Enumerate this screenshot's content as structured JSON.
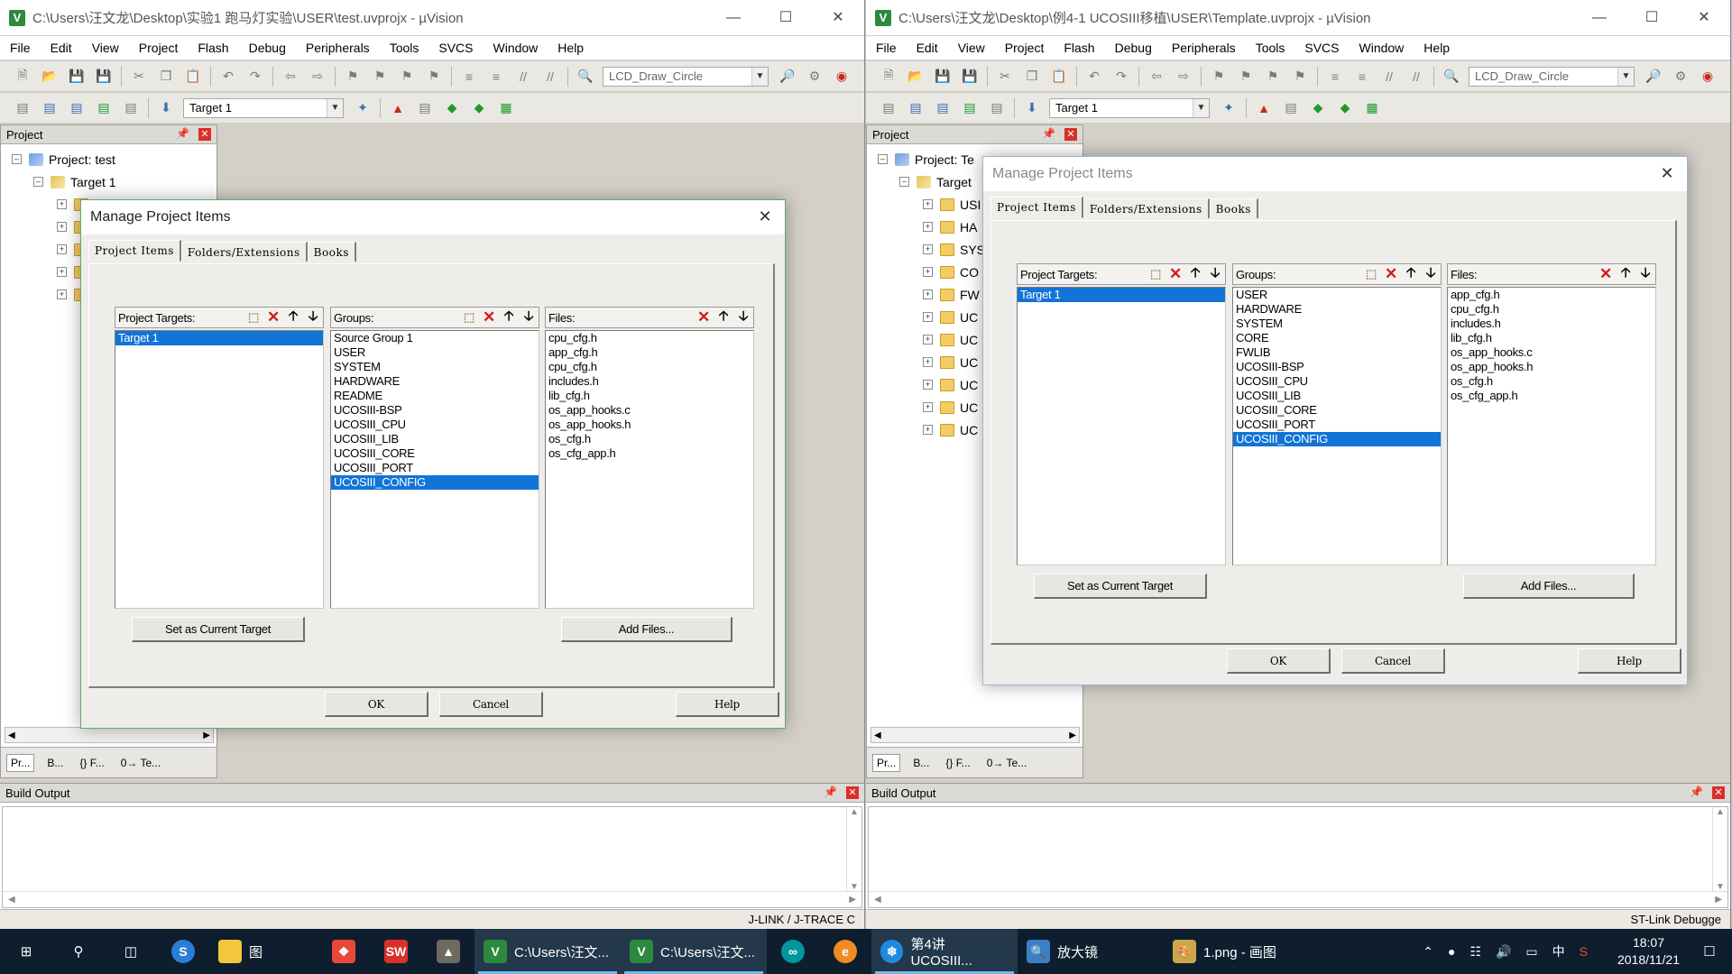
{
  "menu": [
    "File",
    "Edit",
    "View",
    "Project",
    "Flash",
    "Debug",
    "Peripherals",
    "Tools",
    "SVCS",
    "Window",
    "Help"
  ],
  "left": {
    "title": "C:\\Users\\汪文龙\\Desktop\\实验1 跑马灯实验\\USER\\test.uvprojx - µVision",
    "find_combo": "LCD_Draw_Circle",
    "target_combo": "Target 1",
    "panel_title": "Project",
    "tree_project": "Project: test",
    "tree_target": "Target 1",
    "bottom_tabs": [
      "Pr...",
      "B...",
      "{} F...",
      "0→ Te..."
    ],
    "build_output_title": "Build Output",
    "status": "J-LINK / J-TRACE C",
    "dialog": {
      "title": "Manage Project Items",
      "tabs": [
        "Project Items",
        "Folders/Extensions",
        "Books"
      ],
      "targets_label": "Project Targets:",
      "groups_label": "Groups:",
      "files_label": "Files:",
      "targets": [
        "Target 1"
      ],
      "selected_target": "Target 1",
      "groups": [
        "Source Group 1",
        "USER",
        "SYSTEM",
        "HARDWARE",
        "README",
        "UCOSIII-BSP",
        "UCOSIII_CPU",
        "UCOSIII_LIB",
        "UCOSIII_CORE",
        "UCOSIII_PORT",
        "UCOSIII_CONFIG"
      ],
      "selected_group": "UCOSIII_CONFIG",
      "files": [
        "cpu_cfg.h",
        "app_cfg.h",
        "cpu_cfg.h",
        "includes.h",
        "lib_cfg.h",
        "os_app_hooks.c",
        "os_app_hooks.h",
        "os_cfg.h",
        "os_cfg_app.h"
      ],
      "set_current_target": "Set as Current Target",
      "add_files": "Add Files...",
      "ok": "OK",
      "cancel": "Cancel",
      "help": "Help"
    }
  },
  "right": {
    "title": "C:\\Users\\汪文龙\\Desktop\\例4-1 UCOSIII移植\\USER\\Template.uvprojx - µVision",
    "find_combo": "LCD_Draw_Circle",
    "target_combo": "Target 1",
    "panel_title": "Project",
    "tree_project": "Project: Te",
    "tree_target": "Target",
    "tree_folders": [
      "USI",
      "HA",
      "SYS",
      "CO",
      "FW",
      "UC",
      "UC",
      "UC",
      "UC",
      "UC",
      "UC"
    ],
    "bottom_tabs": [
      "Pr...",
      "B...",
      "{} F...",
      "0→ Te..."
    ],
    "build_output_title": "Build Output",
    "status": "ST-Link Debugge",
    "dialog": {
      "title": "Manage Project Items",
      "tabs": [
        "Project Items",
        "Folders/Extensions",
        "Books"
      ],
      "targets_label": "Project Targets:",
      "groups_label": "Groups:",
      "files_label": "Files:",
      "targets": [
        "Target 1"
      ],
      "selected_target": "Target 1",
      "groups": [
        "USER",
        "HARDWARE",
        "SYSTEM",
        "CORE",
        "FWLIB",
        "UCOSIII-BSP",
        "UCOSIII_CPU",
        "UCOSIII_LIB",
        "UCOSIII_CORE",
        "UCOSIII_PORT",
        "UCOSIII_CONFIG"
      ],
      "selected_group": "UCOSIII_CONFIG",
      "files": [
        "app_cfg.h",
        "cpu_cfg.h",
        "includes.h",
        "lib_cfg.h",
        "os_app_hooks.c",
        "os_app_hooks.h",
        "os_cfg.h",
        "os_cfg_app.h"
      ],
      "set_current_target": "Set as Current Target",
      "add_files": "Add Files...",
      "ok": "OK",
      "cancel": "Cancel",
      "help": "Help"
    }
  },
  "taskbar": {
    "items": [
      {
        "icon": "windows-start-icon",
        "label": ""
      },
      {
        "icon": "search-icon",
        "label": ""
      },
      {
        "icon": "task-view-icon",
        "label": ""
      },
      {
        "icon": "browser-icon",
        "label": ""
      },
      {
        "icon": "file-explorer-icon",
        "label": "图"
      },
      {
        "icon": "app-icon",
        "label": ""
      },
      {
        "icon": "solidworks-icon",
        "label": ""
      },
      {
        "icon": "app-icon",
        "label": ""
      },
      {
        "icon": "keil-icon",
        "label": "C:\\Users\\汪文..."
      },
      {
        "icon": "keil-icon",
        "label": "C:\\Users\\汪文..."
      },
      {
        "icon": "arduino-icon",
        "label": ""
      },
      {
        "icon": "edge-icon",
        "label": ""
      },
      {
        "icon": "app-icon",
        "label": "第4讲 UCOSIII..."
      },
      {
        "icon": "magnifier-icon",
        "label": "放大镜"
      },
      {
        "icon": "paint-icon",
        "label": "1.png - 画图"
      }
    ],
    "ime": "中",
    "time": "18:07",
    "date": "2018/11/21"
  }
}
